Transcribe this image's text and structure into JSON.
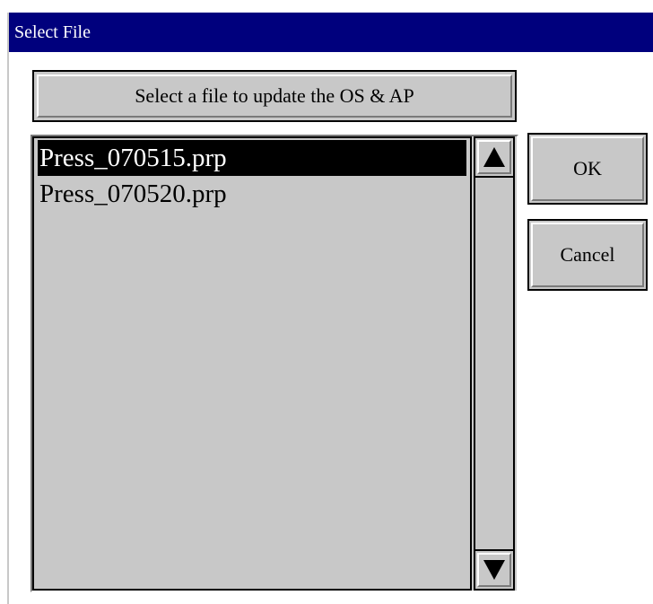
{
  "window": {
    "title": "Select File"
  },
  "instruction": {
    "text": "Select a file to update the OS & AP"
  },
  "file_list": {
    "items": [
      {
        "label": "Press_070515.prp",
        "selected": true
      },
      {
        "label": "Press_070520.prp",
        "selected": false
      }
    ]
  },
  "buttons": {
    "ok_label": "OK",
    "cancel_label": "Cancel"
  },
  "scrollbar": {
    "up_icon": "triangle-up-icon",
    "down_icon": "triangle-down-icon"
  },
  "colors": {
    "titlebar": "#00007d",
    "panel": "#c8c8c8",
    "selection": "#000000"
  }
}
